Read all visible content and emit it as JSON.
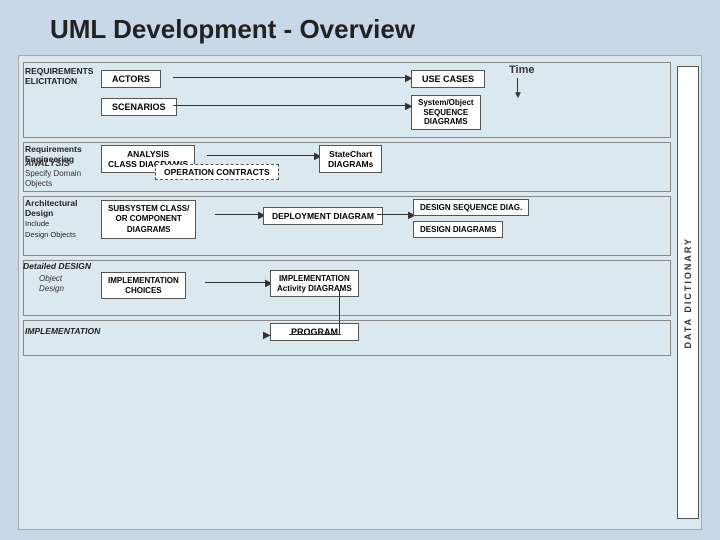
{
  "page": {
    "title": "UML Development - Overview",
    "background_color": "#c8d8e8"
  },
  "right_bar": {
    "label": "DATA DICTIONARY"
  },
  "time_label": "Time",
  "sections": {
    "requirements_elicitation": {
      "label": "REQUIREMENTS ELICITATION",
      "actors": "ACTORS",
      "use_cases": "USE CASES",
      "scenarios": "SCENARIOS",
      "sys_obj": "System/Object\nSEQUENCE\nDIAGRAMS"
    },
    "requirements_engineering": {
      "label": "Requirements\nEngineering",
      "analysis_title": "ANALYSIS",
      "analysis_sub": "Specify Domain\nObjects",
      "analysis_box": "ANALYSIS\nCLASS DIAGRAM(S",
      "statechart": "StateChart\nDIAGRAMs",
      "op_contracts": "OPERATION CONTRACTS"
    },
    "architectural_design": {
      "label": "Architectural\nDesign",
      "include": "Include\nDesign Objects",
      "subsystem": "SUBSYSTEM CLASS/\nOR COMPONENT\nDIAGRAMS",
      "deployment": "DEPLOYMENT DIAGRAM",
      "design_seq": "DESIGN SEQUENCE DIAG.",
      "design_diag": "DESIGN DIAGRAMS"
    },
    "detailed_design": {
      "label": "Detailed DESIGN",
      "object_design_label": "Object\nDesign",
      "impl_choices": "IMPLEMENTATION\nCHOICES",
      "impl_activity": "IMPLEMENTATION\nActivity DIAGRAMS"
    },
    "implementation": {
      "label": "IMPLEMENTATION",
      "program": "PROGRAM"
    }
  }
}
